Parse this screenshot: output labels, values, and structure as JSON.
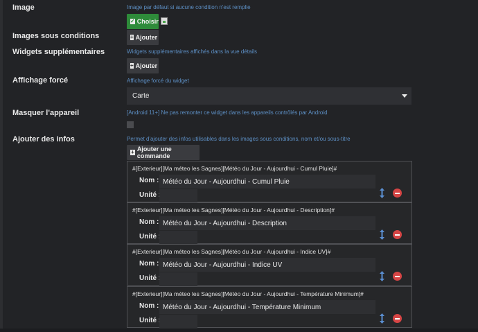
{
  "image": {
    "label": "Image",
    "help": "Image par défaut si aucune condition n'est remplie",
    "choose_button": "Choisir"
  },
  "images_conditions": {
    "label": "Images sous conditions",
    "add_button": "Ajouter"
  },
  "widgets": {
    "label": "Widgets supplémentaires",
    "help": "Widgets supplémentaires affichés dans la vue détails",
    "add_button": "Ajouter"
  },
  "display": {
    "label": "Affichage forcé",
    "help": "Affichage forcé du widget",
    "selected": "Carte"
  },
  "hide_device": {
    "label": "Masquer l'appareil",
    "help": "[Android 11+] Ne pas remonter ce widget dans les appareils contrôlés par Android",
    "checked": false
  },
  "infos": {
    "label": "Ajouter des infos",
    "help": "Permet d'ajouter des infos utilisables dans les images sous conditions, nom et/ou sous-titre",
    "add_command_button": "Ajouter une commande",
    "name_label": "Nom :",
    "unit_label": "Unité :",
    "items": [
      {
        "command": "#[Exterieur][Ma méteo les Sagnes][Météo du Jour - Aujourdhui - Cumul Pluie]#",
        "name": "Météo du Jour - Aujourdhui - Cumul Pluie",
        "unit": ""
      },
      {
        "command": "#[Exterieur][Ma méteo les Sagnes][Météo du Jour - Aujourdhui - Description]#",
        "name": "Météo du Jour - Aujourdhui - Description",
        "unit": ""
      },
      {
        "command": "#[Exterieur][Ma méteo les Sagnes][Météo du Jour - Aujourdhui - Indice UV]#",
        "name": "Météo du Jour - Aujourdhui - Indice UV",
        "unit": ""
      },
      {
        "command": "#[Exterieur][Ma méteo les Sagnes][Météo du Jour - Aujourdhui - Température Minimum]#",
        "name": "Météo du Jour - Aujourdhui - Température Minimum",
        "unit": ""
      }
    ]
  },
  "colors": {
    "background": "#222326",
    "accent_green": "#2e8b3a",
    "help_text": "#5d8fc4",
    "danger": "#d64545",
    "arrow_blue": "#5b8fd1"
  }
}
